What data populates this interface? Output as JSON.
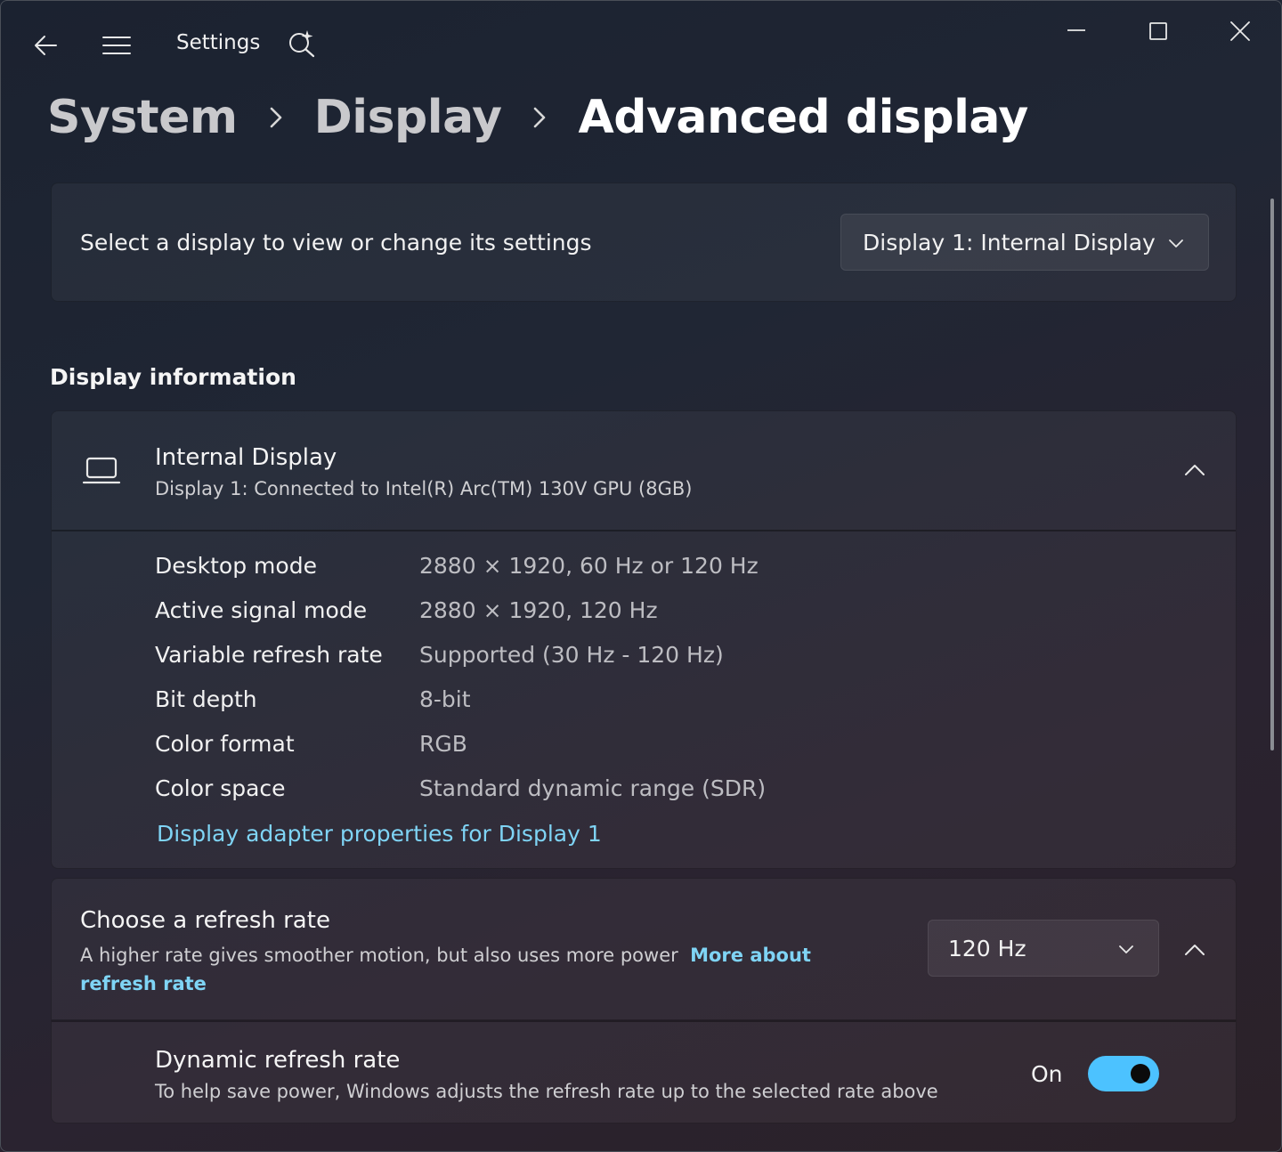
{
  "titlebar": {
    "app_title": "Settings",
    "icons": {
      "back": "back-arrow-icon",
      "menu": "hamburger-menu-icon",
      "copilot": "search-sparkle-icon",
      "minimize": "minimize-icon",
      "maximize": "maximize-icon",
      "close": "close-icon"
    }
  },
  "breadcrumb": {
    "items": [
      "System",
      "Display",
      "Advanced display"
    ],
    "separator_icon": "chevron-right-icon"
  },
  "display_select": {
    "label": "Select a display to view or change its settings",
    "selected": "Display 1: Internal Display"
  },
  "display_info": {
    "section_title": "Display information",
    "title": "Internal Display",
    "subtitle": "Display 1: Connected to Intel(R) Arc(TM) 130V GPU (8GB)",
    "icon": "laptop-icon",
    "expanded": true,
    "rows": [
      {
        "label": "Desktop mode",
        "value": "2880 × 1920, 60 Hz or 120 Hz"
      },
      {
        "label": "Active signal mode",
        "value": "2880 × 1920, 120 Hz"
      },
      {
        "label": "Variable refresh rate",
        "value": "Supported (30 Hz - 120 Hz)"
      },
      {
        "label": "Bit depth",
        "value": "8-bit"
      },
      {
        "label": "Color format",
        "value": "RGB"
      },
      {
        "label": "Color space",
        "value": "Standard dynamic range (SDR)"
      }
    ],
    "adapter_link": "Display adapter properties for Display 1"
  },
  "refresh_rate": {
    "title": "Choose a refresh rate",
    "description": "A higher rate gives smoother motion, but also uses more power",
    "link": "More about refresh rate",
    "selected": "120 Hz",
    "expanded": true
  },
  "dynamic_refresh": {
    "title": "Dynamic refresh rate",
    "description": "To help save power, Windows adjusts the refresh rate up to the selected rate above",
    "state_label": "On",
    "enabled": true
  },
  "colors": {
    "accent": "#4cc2ff",
    "link": "#7fd4f5"
  }
}
